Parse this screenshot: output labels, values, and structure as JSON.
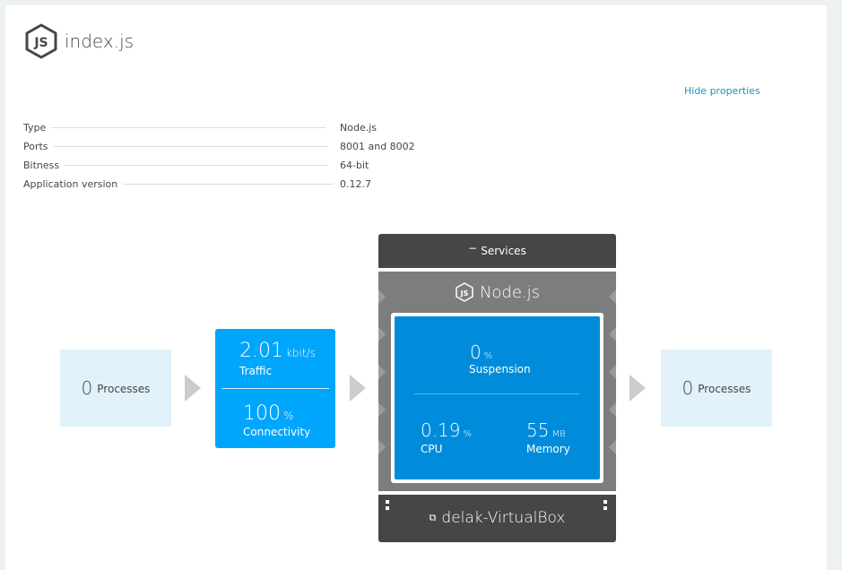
{
  "header": {
    "title": "index.js",
    "icon": "nodejs-logo-icon"
  },
  "hide_properties": "Hide properties",
  "properties": [
    {
      "key": "Type",
      "value": "Node.js"
    },
    {
      "key": "Ports",
      "value": "8001 and 8002"
    },
    {
      "key": "Bitness",
      "value": "64-bit"
    },
    {
      "key": "Application version",
      "value": "0.12.7"
    }
  ],
  "left_processes": {
    "count": "0",
    "label": "Processes"
  },
  "right_processes": {
    "count": "0",
    "label": "Processes"
  },
  "traffic": {
    "value": "2.01",
    "unit": "kbit/s",
    "label": "Traffic"
  },
  "connectivity": {
    "value": "100",
    "unit": "%",
    "label": "Connectivity"
  },
  "services": {
    "header": "Services",
    "title": "Node.js",
    "suspension": {
      "value": "0",
      "unit": "%",
      "label": "Suspension"
    },
    "cpu": {
      "value": "0.19",
      "unit": "%",
      "label": "CPU"
    },
    "memory": {
      "value": "55",
      "unit": "MB",
      "label": "Memory"
    },
    "host": "delak-VirtualBox"
  },
  "colors": {
    "accent_blue": "#00a6fb",
    "inner_blue": "#008cdb",
    "dark_gray": "#454646",
    "mid_gray": "#7c7e7e",
    "light_blue_box": "#e1f2fa",
    "link": "#1496be"
  }
}
